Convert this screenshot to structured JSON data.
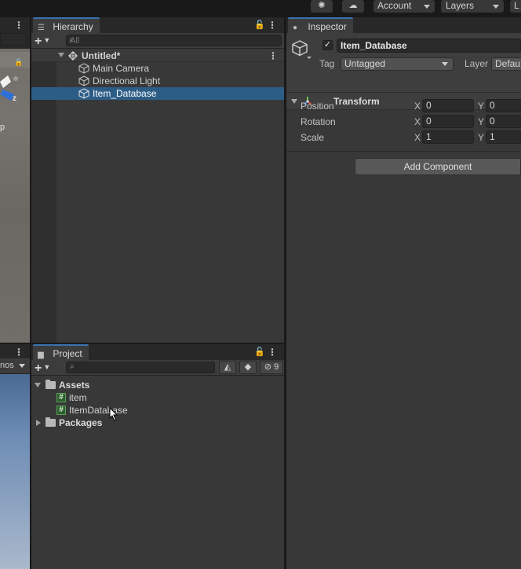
{
  "toolbar": {
    "account_label": "Account",
    "layers_label": "Layers",
    "layout_label": "L",
    "collab_icon": "collab-icon",
    "cloud_icon": "cloud-icon"
  },
  "scene": {
    "axis_label": "z",
    "persp_label": "p"
  },
  "game": {
    "gizmos_label": "nos"
  },
  "hierarchy": {
    "tab_label": "Hierarchy",
    "search_placeholder": "All",
    "scene_name": "Untitled*",
    "items": [
      {
        "label": "Main Camera"
      },
      {
        "label": "Directional Light"
      },
      {
        "label": "Item_Database"
      }
    ]
  },
  "project": {
    "tab_label": "Project",
    "hidden_count": "9",
    "tree": {
      "assets_label": "Assets",
      "files": [
        {
          "label": "item"
        },
        {
          "label": "ItemDatabase"
        }
      ],
      "packages_label": "Packages"
    }
  },
  "inspector": {
    "tab_label": "Inspector",
    "object_name": "Item_Database",
    "tag_label": "Tag",
    "tag_value": "Untagged",
    "layer_label": "Layer",
    "layer_value": "Defau",
    "component_title": "Transform",
    "rows": [
      {
        "name": "Position",
        "x_label": "X",
        "x": "0",
        "y_label": "Y",
        "y": "0"
      },
      {
        "name": "Rotation",
        "x_label": "X",
        "x": "0",
        "y_label": "Y",
        "y": "0"
      },
      {
        "name": "Scale",
        "x_label": "X",
        "x": "1",
        "y_label": "Y",
        "y": "1"
      }
    ],
    "add_component_label": "Add Component"
  },
  "colors": {
    "selection": "#2c5d87",
    "panel_bg": "#383838",
    "tab_accent": "#3a72b0",
    "script_icon": "#59a356"
  }
}
